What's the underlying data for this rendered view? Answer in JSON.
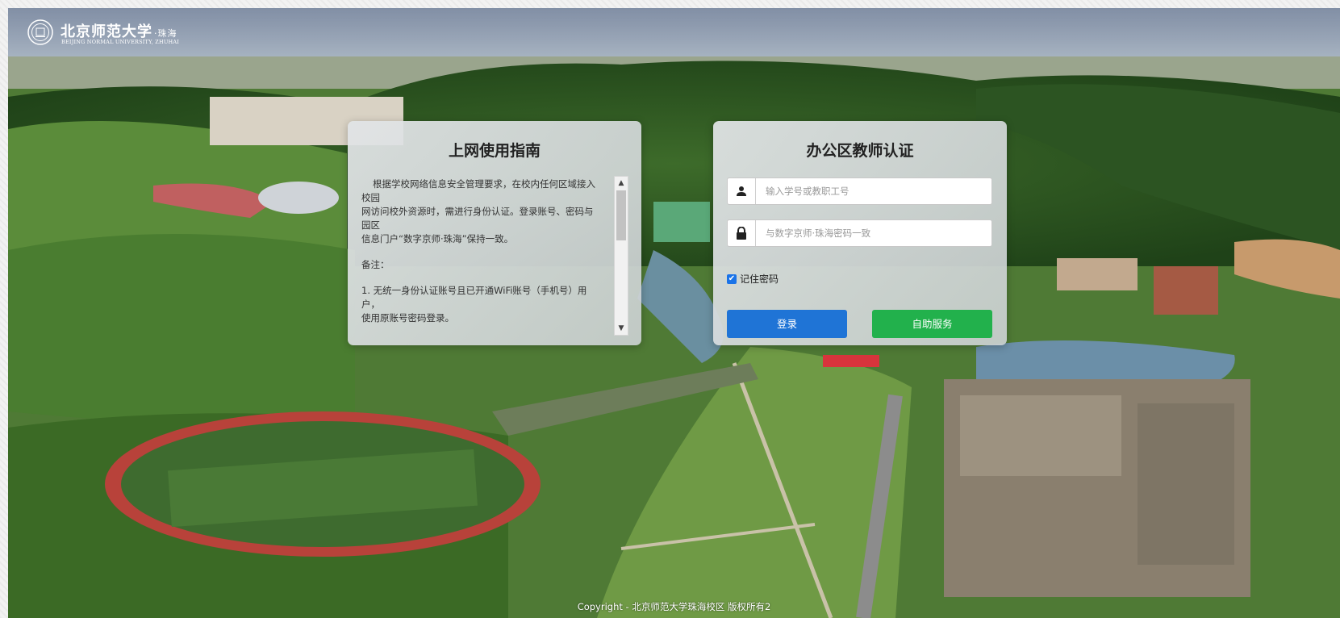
{
  "header": {
    "logo_cn": "北京师范大学",
    "logo_cn_sub": "·珠海",
    "logo_en": "BEIJING NORMAL UNIVERSITY, ZHUHAI"
  },
  "guide": {
    "title": "上网使用指南",
    "para1_l1": "根据学校网络信息安全管理要求，在校内任何区域接入",
    "para1_l2": "校园",
    "para1_l3": "网访问校外资源时，需进行身份认证。登录账号、密码与",
    "para1_l4": "园区",
    "para1_l5": "信息门户“数字京师·珠海”保持一致。",
    "note_label": "备注：",
    "note1_l1": "1. 无统一身份认证账号且已开通WiFi账号（手机号）用",
    "note1_l2": "户，",
    "note1_l3": "使用原账号密码登录。"
  },
  "auth": {
    "title": "办公区教师认证",
    "username_placeholder": "输入学号或教职工号",
    "password_placeholder": "与数字京师·珠海密码一致",
    "remember_label": "记住密码",
    "remember_checked": true,
    "login_label": "登录",
    "self_service_label": "自助服务"
  },
  "footer": {
    "copyright": "Copyright - 北京师范大学珠海校区 版权所有2"
  },
  "colors": {
    "login_button": "#1f74d6",
    "self_service_button": "#22b14c",
    "checkbox": "#1a73e8"
  },
  "icons": {
    "user": "user-icon",
    "lock": "lock-icon",
    "seal": "university-seal-icon"
  }
}
